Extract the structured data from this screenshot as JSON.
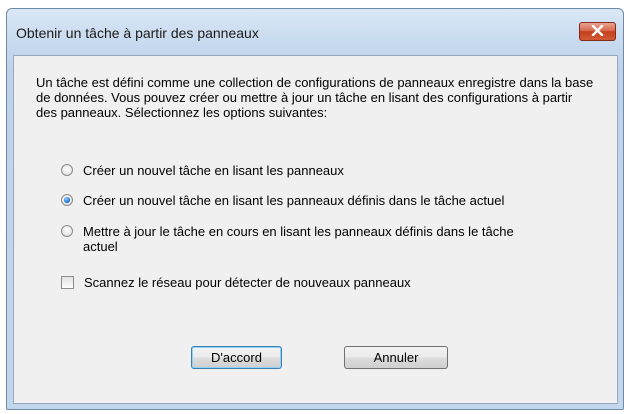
{
  "dialog": {
    "title": "Obtenir un tâche à partir des panneaux",
    "close_glyph": "✕"
  },
  "description": "Un tâche est défini comme une collection de configurations de panneaux enregistre dans la base de données. Vous pouvez créer ou mettre à jour un tâche en lisant des configurations à partir des panneaux. Sélectionnez les options suivantes:",
  "options": [
    {
      "label": "Créer un nouvel tâche en lisant les panneaux",
      "selected": false
    },
    {
      "label": "Créer un nouvel tâche en lisant les panneaux définis dans le tâche actuel",
      "selected": true
    },
    {
      "label": "Mettre à jour le tâche en cours en lisant les panneaux définis dans le tâche actuel",
      "selected": false
    }
  ],
  "scan_checkbox": {
    "label": "Scannez le réseau pour détecter de nouveaux panneaux",
    "checked": false
  },
  "buttons": {
    "ok": "D'accord",
    "cancel": "Annuler"
  },
  "colors": {
    "frame": "#c3d7ec",
    "client": "#f0f0f0",
    "close": "#c4401f",
    "radio_selected": "#1f79d8"
  }
}
